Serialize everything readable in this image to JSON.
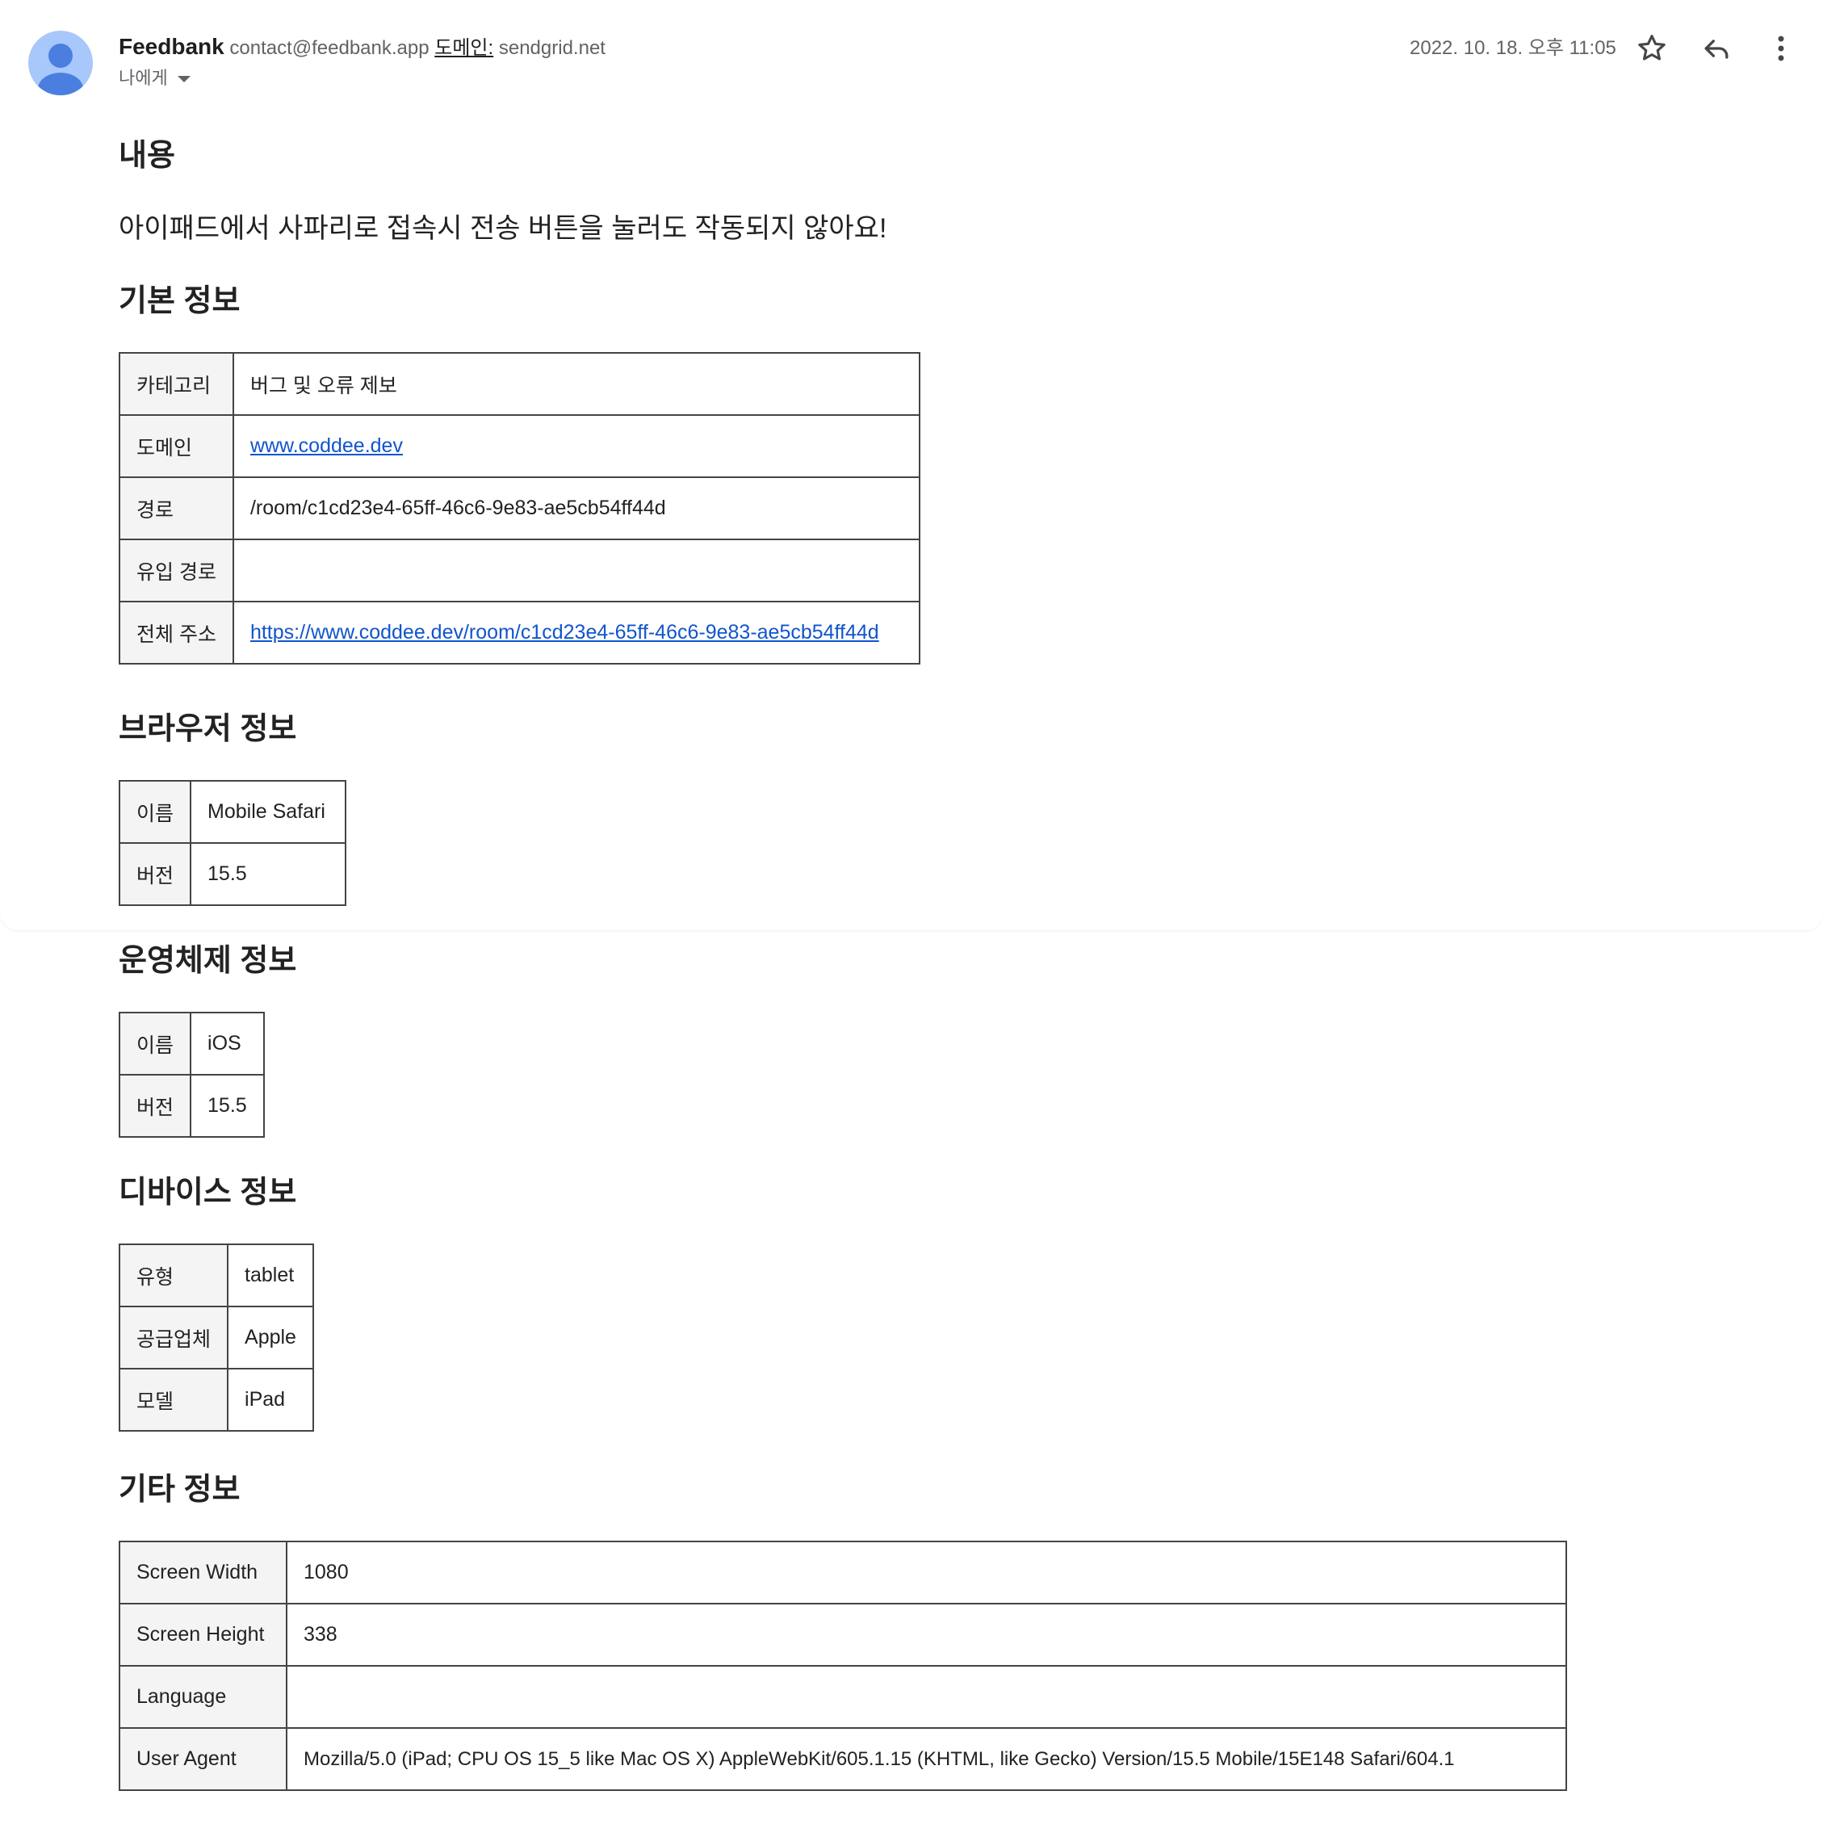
{
  "header": {
    "sender_name": "Feedbank",
    "sender_email": "contact@feedbank.app",
    "domain_label": "도메인:",
    "domain_value": "sendgrid.net",
    "recipient": "나에게",
    "date": "2022. 10. 18. 오후 11:05",
    "icons": [
      "star-icon",
      "reply-icon",
      "more-vert-icon"
    ]
  },
  "content": {
    "heading": "내용",
    "text": "아이패드에서 사파리로 접속시 전송 버튼을 눌러도 작동되지 않아요!"
  },
  "basic_info": {
    "heading": "기본 정보",
    "rows": [
      {
        "key": "카테고리",
        "value": "버그 및 오류 제보"
      },
      {
        "key": "도메인",
        "value": "www.coddee.dev"
      },
      {
        "key": "경로",
        "value": "/room/c1cd23e4-65ff-46c6-9e83-ae5cb54ff44d"
      },
      {
        "key": "유입 경로",
        "value": ""
      },
      {
        "key": "전체 주소",
        "value": "https://www.coddee.dev/room/c1cd23e4-65ff-46c6-9e83-ae5cb54ff44d"
      }
    ]
  },
  "browser_info": {
    "heading": "브라우저 정보",
    "rows": [
      {
        "key": "이름",
        "value": "Mobile Safari"
      },
      {
        "key": "버전",
        "value": "15.5"
      }
    ]
  },
  "os_info": {
    "heading": "운영체제 정보",
    "rows": [
      {
        "key": "이름",
        "value": "iOS"
      },
      {
        "key": "버전",
        "value": "15.5"
      }
    ]
  },
  "device_info": {
    "heading": "디바이스 정보",
    "rows": [
      {
        "key": "유형",
        "value": "tablet"
      },
      {
        "key": "공급업체",
        "value": "Apple"
      },
      {
        "key": "모델",
        "value": "iPad"
      }
    ]
  },
  "other_info": {
    "heading": "기타 정보",
    "rows": [
      {
        "key": "Screen Width",
        "value": "1080"
      },
      {
        "key": "Screen Height",
        "value": "338"
      },
      {
        "key": "Language",
        "value": ""
      },
      {
        "key": "User Agent",
        "value": "Mozilla/5.0 (iPad; CPU OS 15_5 like Mac OS X) AppleWebKit/605.1.15 (KHTML, like Gecko) Version/15.5 Mobile/15E148 Safari/604.1"
      }
    ]
  },
  "colors": {
    "link": "#1155cc",
    "avatar_bg": "#a8c7fa",
    "avatar_fg": "#4a7fe0"
  }
}
